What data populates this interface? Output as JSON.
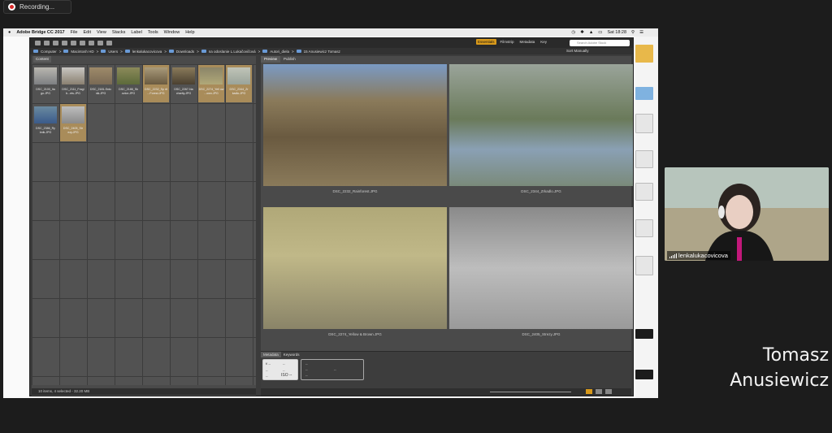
{
  "recording": {
    "label": "Recording..."
  },
  "mac_menubar": {
    "app_name": "Adobe Bridge CC 2017",
    "items": [
      "File",
      "Edit",
      "View",
      "Stacks",
      "Label",
      "Tools",
      "Window",
      "Help"
    ],
    "clock": "Sat 18:28"
  },
  "bridge": {
    "workspaces": [
      "Essentials",
      "Filmstrip",
      "Metadata",
      "Key"
    ],
    "active_workspace": "Essentials",
    "search_placeholder": "Search Adobe Stock",
    "path": [
      "Computer",
      "Macintosh HD",
      "Users",
      "lenkalukacovicova",
      "Downloads",
      "na odoslanie L.Lukačovičová",
      "Autori_diela",
      "15 Anusiewicz Tomasz"
    ],
    "sort_label": "Sort Manually",
    "content_panel_tab": "Content",
    "preview_tabs": [
      "Preview",
      "Publish"
    ],
    "metadata_tabs": [
      "Metadata",
      "Keywords"
    ],
    "thumbnails": [
      {
        "label": "DSC_2100_Ita go.JPG",
        "selected": false,
        "colors": [
          "#7d7f82",
          "#b9b7b0"
        ]
      },
      {
        "label": "DSC_2111_Fragi b...ets.JPG",
        "selected": false,
        "colors": [
          "#8a8070",
          "#c8c6c2"
        ]
      },
      {
        "label": "DSC_2181-Srdc nik.JPG",
        "selected": false,
        "colors": [
          "#7a6a55",
          "#9e8a6a"
        ]
      },
      {
        "label": "DSC_2186_Sk ovice.JPG",
        "selected": false,
        "colors": [
          "#5c6a3a",
          "#8c8a5a"
        ]
      },
      {
        "label": "DSC_2232_Sp rit ...Forest.JPG",
        "selected": true,
        "colors": [
          "#6a5a40",
          "#a89a7a"
        ]
      },
      {
        "label": "DSC_2267-Na charity.JPG",
        "selected": false,
        "colors": [
          "#4a4030",
          "#8a7a5a"
        ]
      },
      {
        "label": "DSC_2274_Yell ow ...own.JPG",
        "selected": true,
        "colors": [
          "#b0a878",
          "#8a8468"
        ]
      },
      {
        "label": "DSC_2344_Zr kadlo.JPG",
        "selected": true,
        "colors": [
          "#9aa49a",
          "#c0c4b8"
        ]
      },
      {
        "label": "DSC_2386_Ry bnik.JPG",
        "selected": false,
        "colors": [
          "#3a5a8a",
          "#6a8aa0"
        ]
      },
      {
        "label": "DSC_2405_Str ezy.JPG",
        "selected": true,
        "colors": [
          "#8a8a8a",
          "#bdbdbd"
        ]
      }
    ],
    "preview_captions": [
      "DSC_2232_Rainforest.JPG",
      "DSC_2344_Zrkadlo.JPG",
      "DSC_2274_Yellow & Brown.JPG",
      "DSC_2405_Strezy.JPG"
    ],
    "metadata_box1": {
      "f_number": "f/ --",
      "shutter": "--",
      "iso_dash": "--",
      "iso": "ISO --",
      "second_row_left": "--",
      "second_row_right": "--"
    },
    "metadata_box2": {
      "rows": [
        "--",
        "--",
        "--",
        "--"
      ]
    },
    "status_text": "10 items, 4 selected - 32.20 MB"
  },
  "participant": {
    "name": "lenkalukacovicova"
  },
  "speaker_label": {
    "line1": "Tomasz",
    "line2": "Anusiewicz"
  },
  "colors": {
    "accent_workspace": "#d99a1b",
    "selection": "#a98c5a",
    "recording_dot": "#d92b2b"
  }
}
